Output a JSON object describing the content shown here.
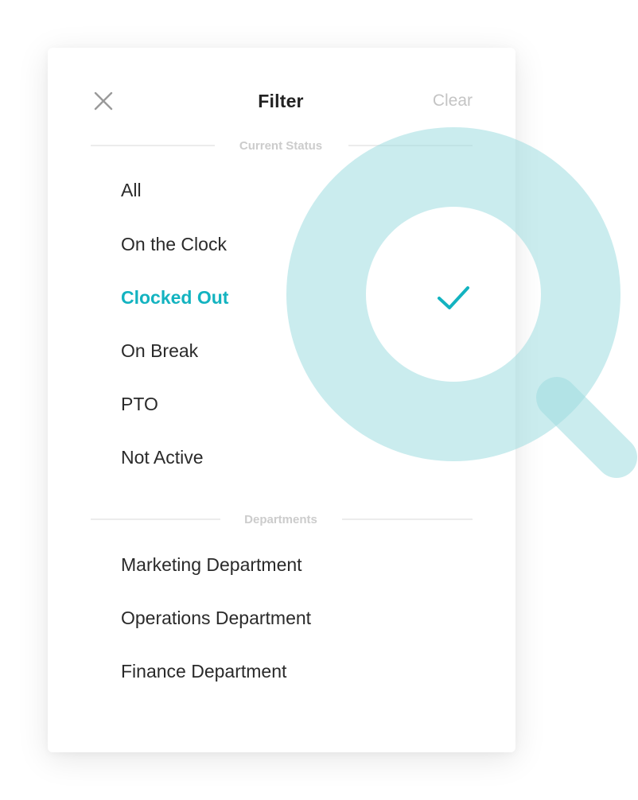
{
  "header": {
    "title": "Filter",
    "clear_label": "Clear",
    "close_icon": "close-icon"
  },
  "sections": {
    "status": {
      "label": "Current Status",
      "items": [
        "All",
        "On the Clock",
        "Clocked Out",
        "On Break",
        "PTO",
        "Not Active"
      ],
      "selected": "Clocked Out"
    },
    "departments": {
      "label": "Departments",
      "items": [
        "Marketing Department",
        "Operations Department",
        "Finance Department"
      ]
    }
  },
  "colors": {
    "accent": "#13b3c0",
    "magnifier": "#9fdde0"
  },
  "icons": {
    "selected": "checkmark-icon",
    "decoration": "magnifier-icon"
  }
}
